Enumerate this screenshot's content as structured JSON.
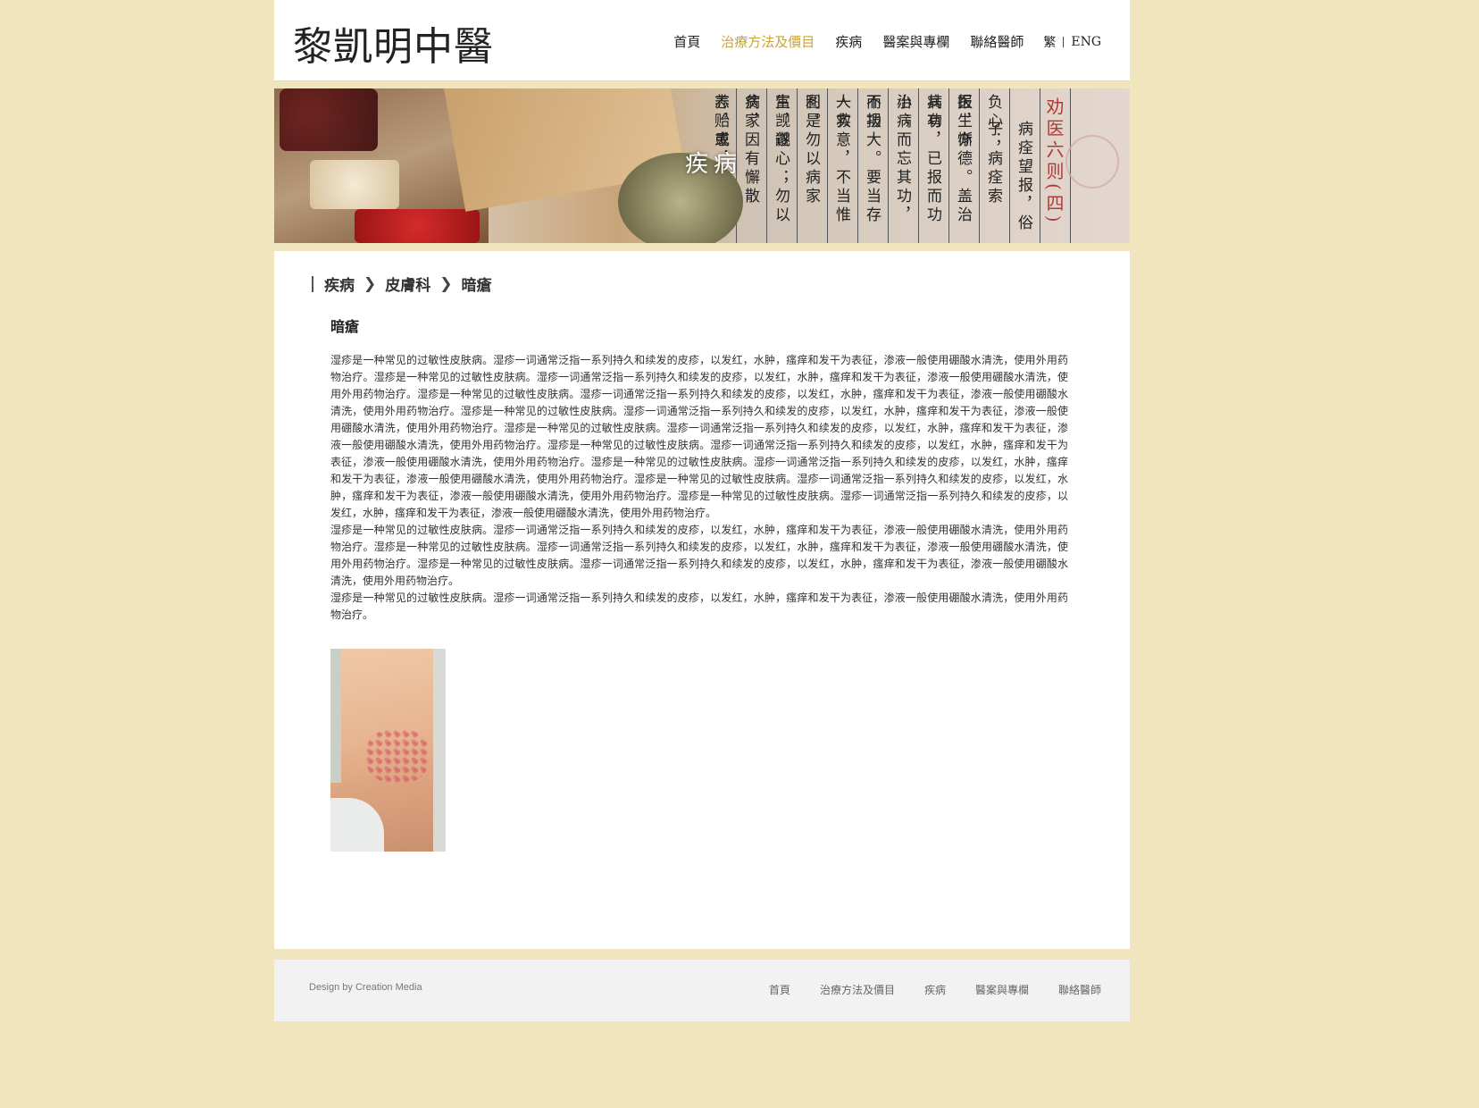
{
  "header": {
    "logo": "黎凱明中醫",
    "nav": [
      {
        "label": "首頁",
        "active": false
      },
      {
        "label": "治療方法及價目",
        "active": true
      },
      {
        "label": "疾病",
        "active": false
      },
      {
        "label": "醫案與專欄",
        "active": false
      },
      {
        "label": "聯絡醫師",
        "active": false
      }
    ],
    "lang": {
      "zh": "繁",
      "en": "ENG"
    }
  },
  "banner": {
    "title": "疾病",
    "calligraphy_title": "劝医六则(四)",
    "calligraphy_columns": [
      "病痊望报，俗子",
      "负心；病痊索报，亦",
      "医生惭德。盖治病有",
      "其功，已报而功小；",
      "治病而忘其功，不报",
      "而功大。要当存一救",
      "人实意，不当惟利是",
      "图。勿以病家富，遂",
      "生觊觎心；勿以病家",
      "贫，因有懈散志，或",
      "养贻患，"
    ]
  },
  "breadcrumb": [
    "疾病",
    "皮膚科",
    "暗瘡"
  ],
  "article": {
    "title": "暗瘡",
    "paragraphs": [
      "湿疹是一种常见的过敏性皮肤病。湿疹一词通常泛指一系列持久和续发的皮疹，以发红，水肿，瘙痒和发干为表征，渗液一般使用硼酸水清洗，使用外用药物治疗。湿疹是一种常见的过敏性皮肤病。湿疹一词通常泛指一系列持久和续发的皮疹，以发红，水肿，瘙痒和发干为表征，渗液一般使用硼酸水清洗，使用外用药物治疗。湿疹是一种常见的过敏性皮肤病。湿疹一词通常泛指一系列持久和续发的皮疹，以发红，水肿，瘙痒和发干为表征，渗液一般使用硼酸水清洗，使用外用药物治疗。湿疹是一种常见的过敏性皮肤病。湿疹一词通常泛指一系列持久和续发的皮疹，以发红，水肿，瘙痒和发干为表征，渗液一般使用硼酸水清洗，使用外用药物治疗。湿疹是一种常见的过敏性皮肤病。湿疹一词通常泛指一系列持久和续发的皮疹，以发红，水肿，瘙痒和发干为表征，渗液一般使用硼酸水清洗，使用外用药物治疗。湿疹是一种常见的过敏性皮肤病。湿疹一词通常泛指一系列持久和续发的皮疹，以发红，水肿，瘙痒和发干为表征，渗液一般使用硼酸水清洗，使用外用药物治疗。湿疹是一种常见的过敏性皮肤病。湿疹一词通常泛指一系列持久和续发的皮疹，以发红，水肿，瘙痒和发干为表征，渗液一般使用硼酸水清洗，使用外用药物治疗。湿疹是一种常见的过敏性皮肤病。湿疹一词通常泛指一系列持久和续发的皮疹，以发红，水肿，瘙痒和发干为表征，渗液一般使用硼酸水清洗，使用外用药物治疗。湿疹是一种常见的过敏性皮肤病。湿疹一词通常泛指一系列持久和续发的皮疹，以发红，水肿，瘙痒和发干为表征，渗液一般使用硼酸水清洗，使用外用药物治疗。",
      "湿疹是一种常见的过敏性皮肤病。湿疹一词通常泛指一系列持久和续发的皮疹，以发红，水肿，瘙痒和发干为表征，渗液一般使用硼酸水清洗，使用外用药物治疗。湿疹是一种常见的过敏性皮肤病。湿疹一词通常泛指一系列持久和续发的皮疹，以发红，水肿，瘙痒和发干为表征，渗液一般使用硼酸水清洗，使用外用药物治疗。湿疹是一种常见的过敏性皮肤病。湿疹一词通常泛指一系列持久和续发的皮疹，以发红，水肿，瘙痒和发干为表征，渗液一般使用硼酸水清洗，使用外用药物治疗。",
      "湿疹是一种常见的过敏性皮肤病。湿疹一词通常泛指一系列持久和续发的皮疹，以发红，水肿，瘙痒和发干为表征，渗液一般使用硼酸水清洗，使用外用药物治疗。"
    ]
  },
  "footer": {
    "credit": "Design by Creation Media",
    "nav": [
      "首頁",
      "治療方法及價目",
      "疾病",
      "醫案與專欄",
      "聯絡醫師"
    ]
  },
  "colors": {
    "page_bg": "#f1e5bd",
    "accent_active": "#c8a43b",
    "footer_bg": "#f2f2f2"
  }
}
